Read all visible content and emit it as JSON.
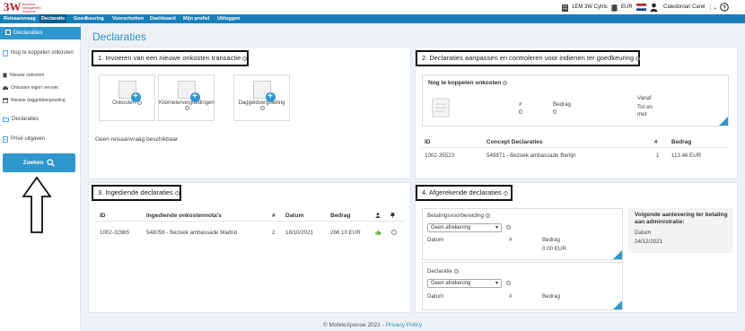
{
  "brand": {
    "logo": "3W",
    "logo_sub": "Business Management Solutions"
  },
  "topright": {
    "company": "1EM 3W Cytric",
    "currency": "EUR",
    "user": "Caledonian Carel"
  },
  "nav": [
    "Reisaanvraag",
    "Declaratie",
    "Goedkeuring",
    "Voorschotten",
    "Dashboard",
    "Mijn profiel",
    "Uitloggen"
  ],
  "sidebar": {
    "active": "Declaraties",
    "nog_te_koppelen": "Nog te koppelen onkosten",
    "sub": [
      "Nieuwe onkosten",
      "Onkosten eigen vervoer.",
      "Nieuwe daggeldvergoeding"
    ],
    "declaraties": "Declaraties",
    "prive": "Privé uitgaven",
    "zoeken": "Zoeken"
  },
  "page_title": "Declaraties",
  "section1": {
    "title": "1. Invoeren van een nieuwe onkosten transactie",
    "tiles": [
      "Onkosten",
      "Kilometervergoedingen",
      "Daggeldvergoeding"
    ],
    "empty_text": "Geen reisaanvraag beschikbaar"
  },
  "section2": {
    "title": "2. Declaraties aanpassen en controleren voor indienen ter goedkeuring",
    "nog_title": "Nog te koppelen onkosten",
    "col_count": "#",
    "col_amount": "Bedrag",
    "count_value": "0",
    "amount_value": "0",
    "vanaf": "Vanaf",
    "tot_en_met": "Tot en met",
    "headers": [
      "ID",
      "Concept Declaraties",
      "#",
      "Bedrag"
    ],
    "rows": [
      [
        "1002-35523",
        "549871 - Bezoek ambassade Berlijn",
        "1",
        "113.46 EUR"
      ]
    ]
  },
  "section3": {
    "title": "3. Ingediende declaraties",
    "headers": [
      "ID",
      "Ingediende onkostennota's",
      "#",
      "Datum",
      "Bedrag"
    ],
    "rows": [
      [
        "1002-32965",
        "548056 - Bezoek ambassade Madrid",
        "2",
        "18/10/2021",
        "266.10 EUR"
      ]
    ]
  },
  "section4": {
    "title": "4. Afgerekende declaraties",
    "betaling_label": "Betalingsvoorbereiding",
    "betaling_select": "Geen afrekening",
    "declaratie_label": "Declaratie",
    "declaratie_select": "Geen afrekening",
    "col_datum": "Datum",
    "col_count": "#",
    "col_bedrag": "Bedrag",
    "betaling_amount": "0.00 EUR",
    "volgende_title": "Volgende aanlevering ter betaling aan administratie:",
    "volgende_datum_label": "Datum",
    "volgende_datum": "24/12/2021"
  },
  "footer": {
    "copyright": "© MobileXpense 2021 -",
    "link": "Privacy Policy"
  }
}
